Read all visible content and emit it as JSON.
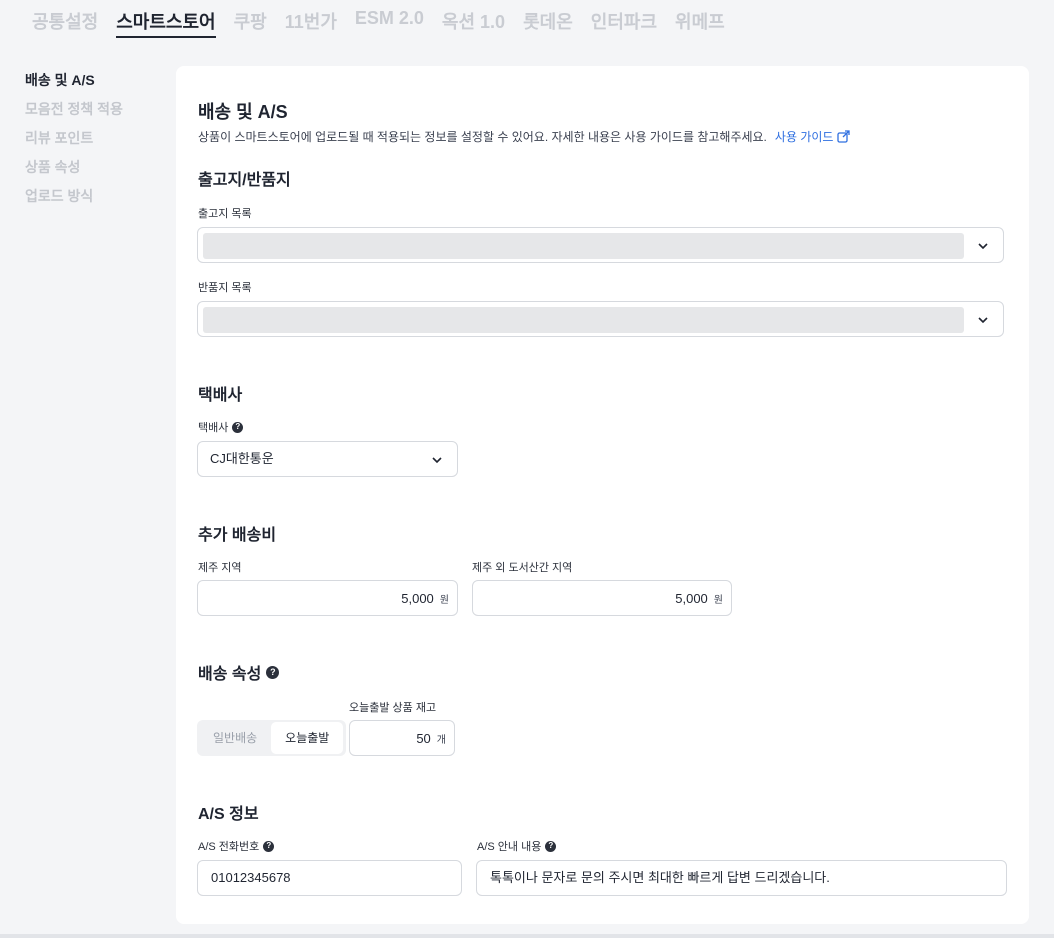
{
  "top_tabs": [
    "공통설정",
    "스마트스토어",
    "쿠팡",
    "11번가",
    "ESM 2.0",
    "옥션 1.0",
    "롯데온",
    "인터파크",
    "위메프"
  ],
  "left_nav": [
    "배송 및 A/S",
    "모음전 정책 적용",
    "리뷰 포인트",
    "상품 속성",
    "업로드 방식"
  ],
  "section": {
    "title": "배송 및 A/S",
    "description": "상품이 스마트스토어에 업로드될 때 적용되는 정보를 설정할 수 있어요. 자세한 내용은 사용 가이드를 참고해주세요.",
    "guide_link": "사용 가이드"
  },
  "address": {
    "title": "출고지/반품지",
    "release_label": "출고지 목록",
    "return_label": "반품지 목록"
  },
  "courier": {
    "title": "택배사",
    "label": "택배사",
    "value": "CJ대한통운"
  },
  "extra_fee": {
    "title": "추가 배송비",
    "jeju_label": "제주 지역",
    "jeju_value": "5,000",
    "island_label": "제주 외 도서산간 지역",
    "island_value": "5,000",
    "unit": "원"
  },
  "shipping_attr": {
    "title": "배송 속성",
    "options": [
      "일반배송",
      "오늘출발"
    ],
    "selected": "오늘출발",
    "stock_label": "오늘출발 상품 재고",
    "stock_value": "50",
    "stock_unit": "개"
  },
  "as_info": {
    "title": "A/S 정보",
    "phone_label": "A/S 전화번호",
    "phone_value": "01012345678",
    "guide_label": "A/S 안내 내용",
    "guide_value": "톡톡이나 문자로 문의 주시면 최대한 빠르게 답변 드리겠습니다."
  },
  "icons": {
    "help": "question-circle-icon",
    "external": "external-link-icon",
    "dropdown": "chevron-down-icon"
  }
}
